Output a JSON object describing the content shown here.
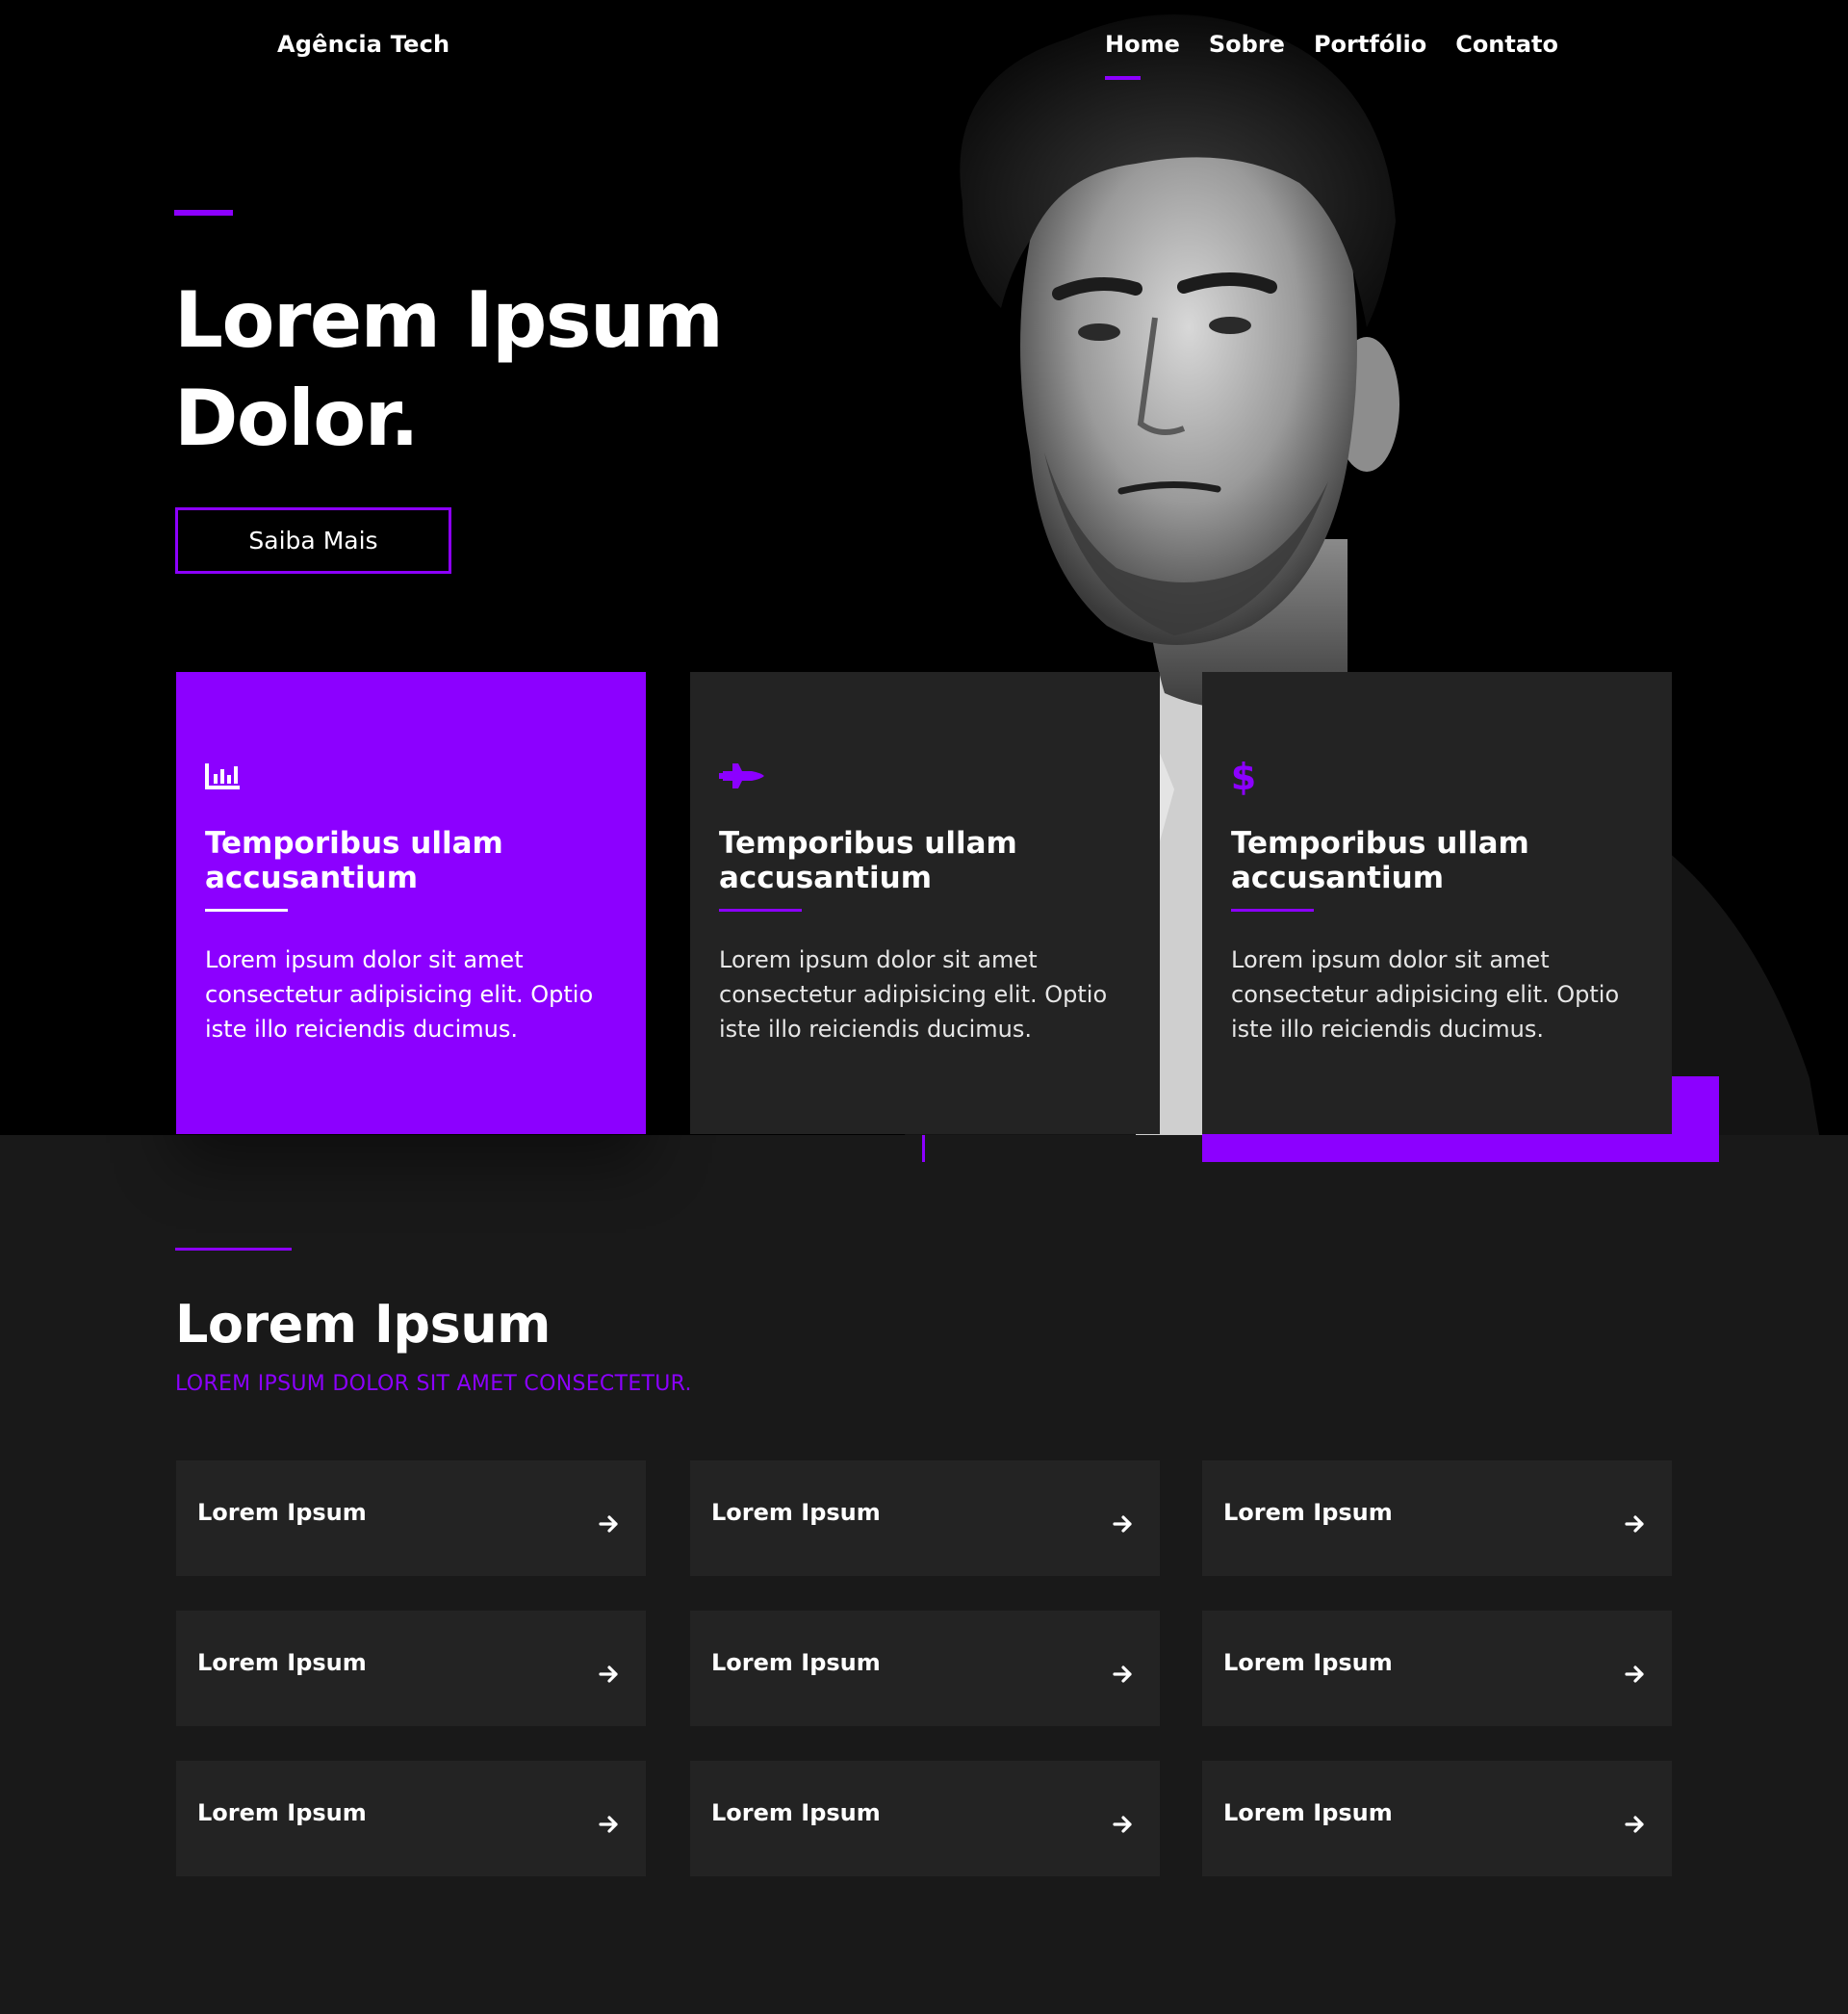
{
  "header": {
    "brand": "Agência Tech",
    "nav": [
      "Home",
      "Sobre",
      "Portfólio",
      "Contato"
    ],
    "active_nav": "Home"
  },
  "hero": {
    "title_line1": "Lorem Ipsum",
    "title_line2": "Dolor.",
    "cta_label": "Saiba Mais"
  },
  "features": [
    {
      "icon": "bar-chart-icon",
      "title": "Temporibus ullam accusantium",
      "text": "Lorem ipsum dolor sit amet consectetur adipisicing elit. Optio iste illo reiciendis ducimus."
    },
    {
      "icon": "space-shuttle-icon",
      "title": "Temporibus ullam accusantium",
      "text": "Lorem ipsum dolor sit amet consectetur adipisicing elit. Optio iste illo reiciendis ducimus."
    },
    {
      "icon": "dollar-icon",
      "title": "Temporibus ullam accusantium",
      "text": "Lorem ipsum dolor sit amet consectetur adipisicing elit. Optio iste illo reiciendis ducimus."
    }
  ],
  "section": {
    "title": "Lorem Ipsum",
    "subtitle": "LOREM IPSUM DOLOR SIT AMET CONSECTETUR."
  },
  "tiles": [
    "Lorem Ipsum",
    "Lorem Ipsum",
    "Lorem Ipsum",
    "Lorem Ipsum",
    "Lorem Ipsum",
    "Lorem Ipsum",
    "Lorem Ipsum",
    "Lorem Ipsum",
    "Lorem Ipsum"
  ],
  "colors": {
    "accent": "#8c00ff",
    "hero_bg": "#000000",
    "page_bg": "#191919",
    "card_bg": "#232323"
  }
}
